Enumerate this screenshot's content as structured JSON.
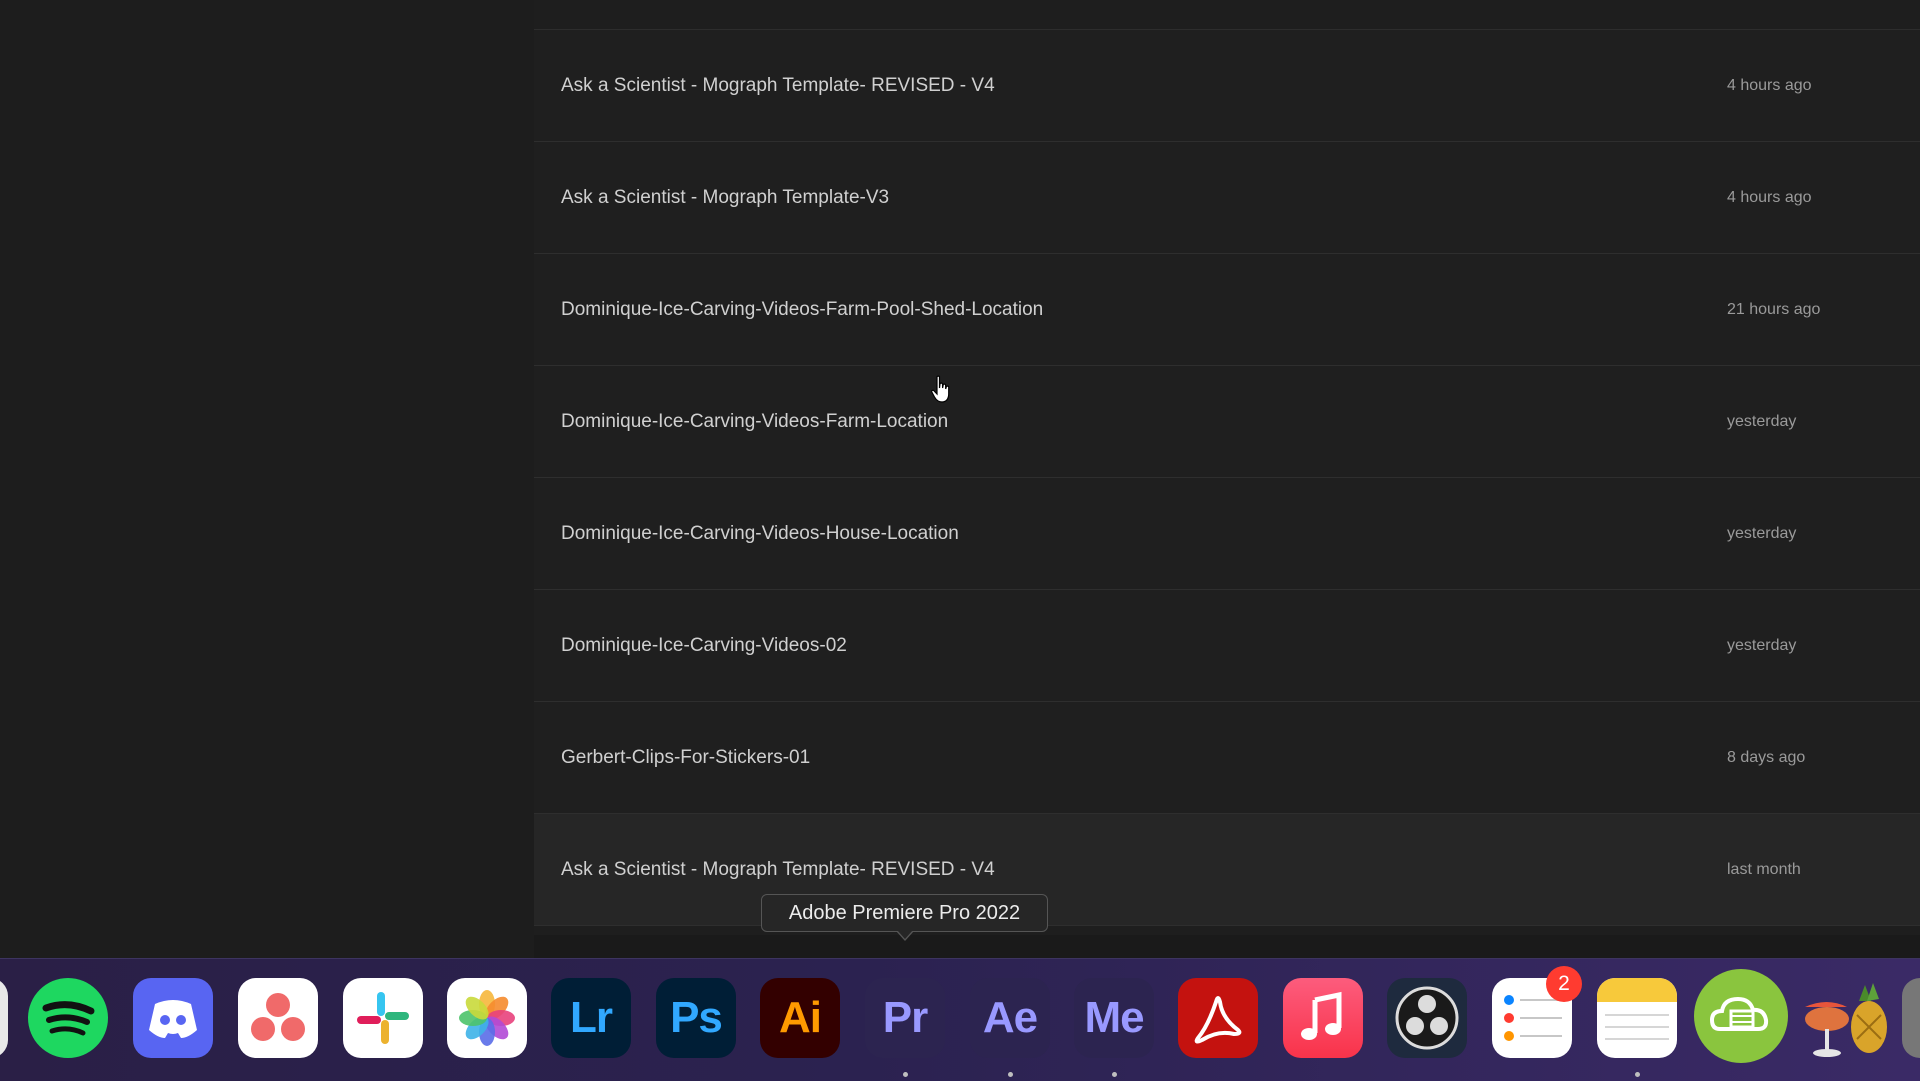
{
  "projects": [
    {
      "name": "Ask a Scientist - Mograph Template- REVISED - V4",
      "modified": "4 hours ago"
    },
    {
      "name": "Ask a Scientist - Mograph Template-V3",
      "modified": "4 hours ago"
    },
    {
      "name": "Dominique-Ice-Carving-Videos-Farm-Pool-Shed-Location",
      "modified": "21 hours ago"
    },
    {
      "name": "Dominique-Ice-Carving-Videos-Farm-Location",
      "modified": "yesterday"
    },
    {
      "name": "Dominique-Ice-Carving-Videos-House-Location",
      "modified": "yesterday"
    },
    {
      "name": "Dominique-Ice-Carving-Videos-02",
      "modified": "yesterday"
    },
    {
      "name": "Gerbert-Clips-For-Stickers-01",
      "modified": "8 days ago"
    },
    {
      "name": "Ask a Scientist - Mograph Template- REVISED - V4",
      "modified": "last month"
    }
  ],
  "tooltip": "Adobe Premiere Pro 2022",
  "dock": {
    "apps": [
      {
        "name": "Spotify",
        "icon": "spotify-icon",
        "running": false
      },
      {
        "name": "Discord",
        "icon": "discord-icon",
        "running": false
      },
      {
        "name": "Asana",
        "icon": "asana-icon",
        "running": false
      },
      {
        "name": "Slack",
        "icon": "slack-icon",
        "running": false
      },
      {
        "name": "Photos",
        "icon": "photos-icon",
        "running": false
      },
      {
        "name": "Lightroom",
        "icon": "lightroom-icon",
        "glyph": "Lr",
        "running": false
      },
      {
        "name": "Photoshop",
        "icon": "photoshop-icon",
        "glyph": "Ps",
        "running": false
      },
      {
        "name": "Illustrator",
        "icon": "illustrator-icon",
        "glyph": "Ai",
        "running": false
      },
      {
        "name": "Premiere Pro",
        "icon": "premiere-icon",
        "glyph": "Pr",
        "running": true
      },
      {
        "name": "After Effects",
        "icon": "after-effects-icon",
        "glyph": "Ae",
        "running": true
      },
      {
        "name": "Media Encoder",
        "icon": "media-encoder-icon",
        "glyph": "Me",
        "running": true
      },
      {
        "name": "Acrobat",
        "icon": "acrobat-icon",
        "running": false
      },
      {
        "name": "Music",
        "icon": "music-icon",
        "running": false
      },
      {
        "name": "OBS",
        "icon": "obs-icon",
        "running": false
      },
      {
        "name": "Reminders",
        "icon": "reminders-icon",
        "badge": "2",
        "running": false
      },
      {
        "name": "Notes",
        "icon": "notes-icon",
        "running": true
      },
      {
        "name": "Cloud video app",
        "icon": "cloud-film-icon",
        "running": false
      },
      {
        "name": "Cocktail app",
        "icon": "cocktail-icon",
        "running": false
      }
    ]
  },
  "colors": {
    "list_bg": "#1f1f1f",
    "hover_row": "#262626",
    "text_primary": "#d0d0d0",
    "text_secondary": "#9a9a9a",
    "dock_bg": "#2b2250"
  }
}
